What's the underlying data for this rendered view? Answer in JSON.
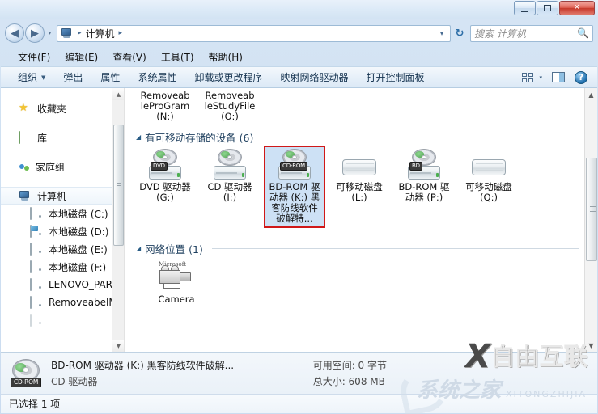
{
  "window": {
    "minimize_label": "最小化",
    "maximize_label": "最大化",
    "close_label": "关闭"
  },
  "address_bar": {
    "back_glyph": "◀",
    "forward_glyph": "▶",
    "dropdown_glyph": "▾",
    "computer_icon": "computer-icon",
    "crumb": "计算机",
    "separator": "▸",
    "refresh_glyph": "↻"
  },
  "search": {
    "placeholder": "搜索 计算机",
    "icon": "search-icon"
  },
  "menubar": {
    "items": [
      {
        "label": "文件(F)"
      },
      {
        "label": "编辑(E)"
      },
      {
        "label": "查看(V)"
      },
      {
        "label": "工具(T)"
      },
      {
        "label": "帮助(H)"
      }
    ]
  },
  "toolbar": {
    "items": [
      {
        "label": "组织",
        "has_caret": true
      },
      {
        "label": "弹出",
        "has_caret": false
      },
      {
        "label": "属性",
        "has_caret": false
      },
      {
        "label": "系统属性",
        "has_caret": false
      },
      {
        "label": "卸载或更改程序",
        "has_caret": false
      },
      {
        "label": "映射网络驱动器",
        "has_caret": false
      },
      {
        "label": "打开控制面板",
        "has_caret": false
      }
    ],
    "view_icon": "view-options-icon",
    "view_caret": "▾",
    "preview_pane_icon": "preview-pane-icon",
    "help_icon": "help-icon",
    "help_glyph": "?"
  },
  "sidebar": {
    "groups": [
      {
        "name": "favorites",
        "label": "收藏夹",
        "icon": "star-icon"
      },
      {
        "name": "libraries",
        "label": "库",
        "icon": "library-icon"
      },
      {
        "name": "homegroup",
        "label": "家庭组",
        "icon": "homegroup-icon"
      }
    ],
    "computer": {
      "label": "计算机",
      "icon": "computer-icon",
      "selected": true
    },
    "drives": [
      {
        "label": "本地磁盘 (C:)",
        "icon": "drive-icon"
      },
      {
        "label": "本地磁盘 (D:)",
        "icon": "drive-system-icon"
      },
      {
        "label": "本地磁盘 (E:)",
        "icon": "drive-icon"
      },
      {
        "label": "本地磁盘 (F:)",
        "icon": "drive-icon"
      },
      {
        "label": "LENOVO_PART",
        "icon": "drive-icon"
      },
      {
        "label": "RemoveabelMo",
        "icon": "drive-icon"
      }
    ],
    "scrollbar": {
      "up": "▲",
      "down": "▼"
    }
  },
  "content": {
    "partial_row": [
      {
        "label": "Removeab\nleProGram\n(N:)"
      },
      {
        "label": "Removeab\nleStudyFile\n(O:)"
      }
    ],
    "sections": [
      {
        "name": "removable-storage",
        "triangle": "◢",
        "label": "有可移动存储的设备 (6)",
        "items": [
          {
            "name": "drive-dvd-g",
            "label": "DVD 驱动器 (G:)",
            "icon": "optical-drive-icon",
            "tag": "DVD",
            "type": "optical",
            "selected": false
          },
          {
            "name": "drive-cd-i",
            "label": "CD 驱动器 (I:)",
            "icon": "optical-drive-icon",
            "tag": "",
            "type": "optical",
            "selected": false
          },
          {
            "name": "drive-bdrom-k",
            "label": "BD-ROM 驱动器 (K:) 黑客防线软件破解特...",
            "icon": "optical-drive-icon",
            "tag": "CD-ROM",
            "type": "optical",
            "selected": true
          },
          {
            "name": "drive-removable-l",
            "label": "可移动磁盘 (L:)",
            "icon": "removable-disk-icon",
            "tag": "",
            "type": "removable",
            "selected": false
          },
          {
            "name": "drive-bdrom-p",
            "label": "BD-ROM 驱动器 (P:)",
            "icon": "optical-drive-icon",
            "tag": "BD",
            "type": "optical",
            "selected": false
          },
          {
            "name": "drive-removable-q",
            "label": "可移动磁盘 (Q:)",
            "icon": "removable-disk-icon",
            "tag": "",
            "type": "removable",
            "selected": false
          }
        ]
      },
      {
        "name": "network-locations",
        "triangle": "◢",
        "label": "网络位置 (1)",
        "items": [
          {
            "name": "network-camera",
            "label": "Camera",
            "icon": "camera-icon",
            "brand": "Microsoft",
            "type": "camera",
            "selected": false
          }
        ]
      }
    ],
    "scrollbar": {
      "up": "▲",
      "down": "▼"
    }
  },
  "details": {
    "icon": "cd-rom-icon",
    "icon_tag": "CD-ROM",
    "title": "BD-ROM 驱动器 (K:) 黑客防线软件破解...",
    "subtitle": "CD 驱动器",
    "free_space": "可用空间: 0 字节",
    "total_size": "总大小: 608 MB"
  },
  "statusbar": {
    "text": "已选择 1 项"
  },
  "watermark": {
    "logo_mark": "X",
    "logo_text": "自由互联",
    "faint_text": "系统之家",
    "faint_sub": "XITONGZHIJIA"
  },
  "colors": {
    "accent": "#2a5d86",
    "selection": "#cde1f5",
    "highlight_border": "#d01818",
    "close_button": "#c73a2c"
  }
}
